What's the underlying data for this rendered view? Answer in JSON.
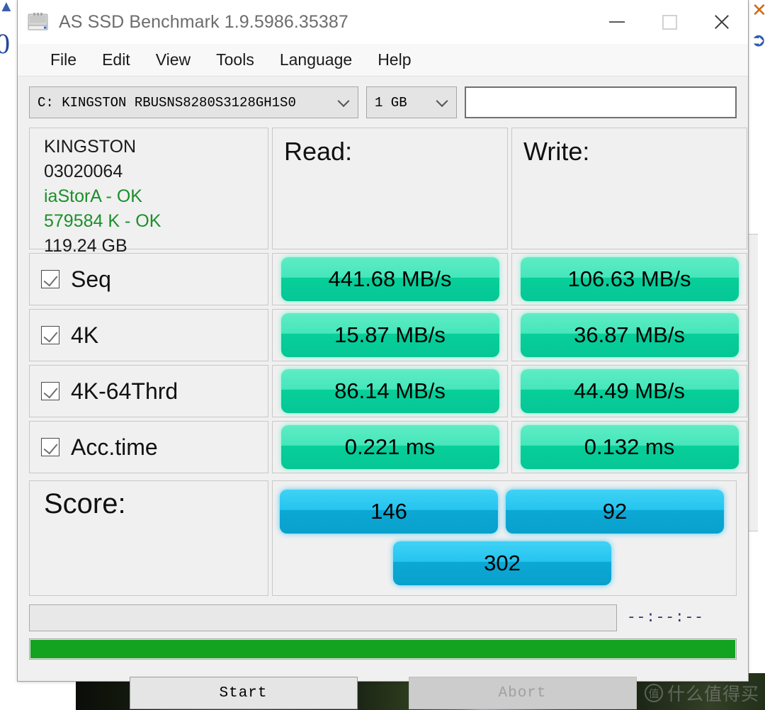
{
  "window": {
    "title": "AS SSD Benchmark 1.9.5986.35387",
    "icon": "ssd-drive-icon",
    "controls": {
      "minimize": "—",
      "maximize": "□",
      "close": "✕"
    }
  },
  "menubar": {
    "items": [
      {
        "label": "File"
      },
      {
        "label": "Edit"
      },
      {
        "label": "View"
      },
      {
        "label": "Tools"
      },
      {
        "label": "Language"
      },
      {
        "label": "Help"
      }
    ]
  },
  "selector": {
    "drive": "C: KINGSTON RBUSNS8280S3128GH1S0",
    "size": "1 GB",
    "textfield_value": "",
    "textfield_placeholder": ""
  },
  "drive_info": {
    "vendor": "KINGSTON",
    "firmware": "03020064",
    "driver": "iaStorA - OK",
    "alignment": "579584 K - OK",
    "capacity": "119.24 GB"
  },
  "columns": {
    "read_header": "Read:",
    "write_header": "Write:"
  },
  "tests": [
    {
      "name": "Seq",
      "checked": true,
      "read": "441.68 MB/s",
      "write": "106.63 MB/s"
    },
    {
      "name": "4K",
      "checked": true,
      "read": "15.87 MB/s",
      "write": "36.87 MB/s"
    },
    {
      "name": "4K-64Thrd",
      "checked": true,
      "read": "86.14 MB/s",
      "write": "44.49 MB/s"
    },
    {
      "name": "Acc.time",
      "checked": true,
      "read": "0.221 ms",
      "write": "0.132 ms"
    }
  ],
  "score": {
    "label": "Score:",
    "read": "146",
    "write": "92",
    "total": "302"
  },
  "footer": {
    "status_text": "",
    "timer": "--:--:--",
    "progress_percent": 100,
    "start_label": "Start",
    "abort_label": "Abort",
    "abort_enabled": false
  },
  "watermark": {
    "badge": "值",
    "text": "什么值得买"
  },
  "colors": {
    "speed_pill_top": "#5fecc4",
    "speed_pill_bottom": "#06c795",
    "score_pill_top": "#3fd2f5",
    "score_pill_bottom": "#0aa0cc",
    "progress_green": "#13a320",
    "ok_text_green": "#1b8f2a",
    "window_chrome": "#f0f0f0"
  }
}
